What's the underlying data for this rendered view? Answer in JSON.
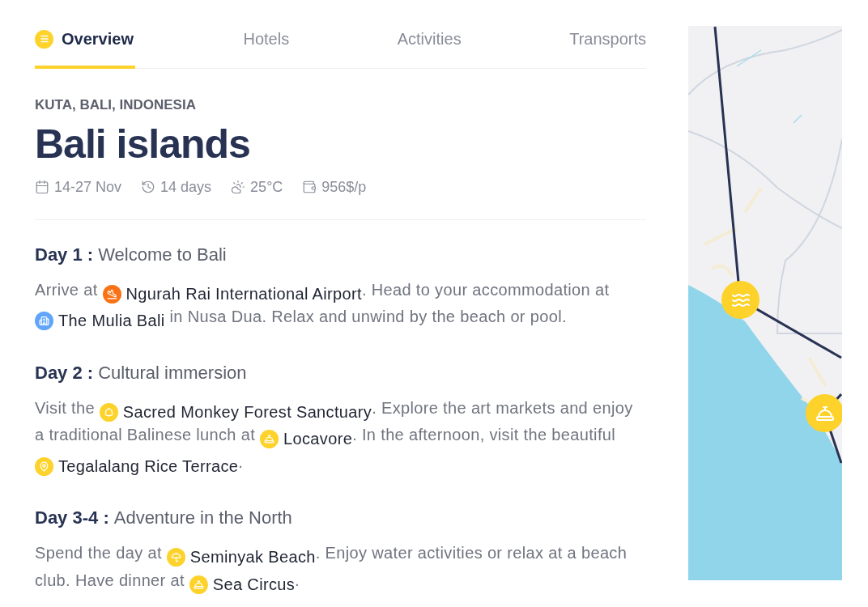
{
  "tabs": [
    {
      "label": "Overview",
      "selected": true
    },
    {
      "label": "Hotels",
      "selected": false
    },
    {
      "label": "Activities",
      "selected": false
    },
    {
      "label": "Transports",
      "selected": false
    }
  ],
  "location": "KUTA, BALI, INDONESIA",
  "title": "Bali islands",
  "meta": [
    {
      "kind": "dates",
      "text": "14-27 Nov"
    },
    {
      "kind": "duration",
      "text": "14 days"
    },
    {
      "kind": "weather",
      "text": "25°C"
    },
    {
      "kind": "price",
      "text": "956$/p"
    }
  ],
  "days": [
    {
      "label": "Day 1 :",
      "title": "Welcome to Bali",
      "body": [
        {
          "text": "Arrive at "
        },
        {
          "place": "Ngurah Rai International Airport",
          "kind": "airport",
          "color": "#f97316"
        },
        {
          "text": ". Head to your accommodation at "
        },
        {
          "place": "The Mulia Bali",
          "kind": "hotel",
          "color": "#60a5fa"
        },
        {
          "text": " in Nusa Dua. Relax and unwind by the beach or pool."
        }
      ]
    },
    {
      "label": "Day 2 :",
      "title": "Cultural immersion",
      "body": [
        {
          "text": "Visit the "
        },
        {
          "place": "Sacred Monkey Forest Sanctuary",
          "kind": "nature",
          "color": "#fdd22a"
        },
        {
          "text": ". Explore the art markets and enjoy a traditional Balinese lunch at "
        },
        {
          "place": "Locavore",
          "kind": "restaurant",
          "color": "#fdd22a"
        },
        {
          "text": ". In the afternoon, visit the beautiful "
        },
        {
          "place": "Tegalalang Rice Terrace",
          "kind": "landmark",
          "color": "#fdd22a"
        },
        {
          "text": "."
        }
      ]
    },
    {
      "label": "Day 3-4 :",
      "title": "Adventure in the North",
      "body": [
        {
          "text": "Spend the day at "
        },
        {
          "place": "Seminyak Beach",
          "kind": "beach",
          "color": "#fdd22a"
        },
        {
          "text": ". Enjoy water activities or relax at a beach club. Have dinner at "
        },
        {
          "place": "Sea Circus",
          "kind": "restaurant",
          "color": "#fdd22a"
        },
        {
          "text": "."
        }
      ]
    }
  ],
  "map": {
    "kind": "picture",
    "markers": [
      {
        "kind": "beach"
      },
      {
        "kind": "restaurant"
      }
    ]
  }
}
